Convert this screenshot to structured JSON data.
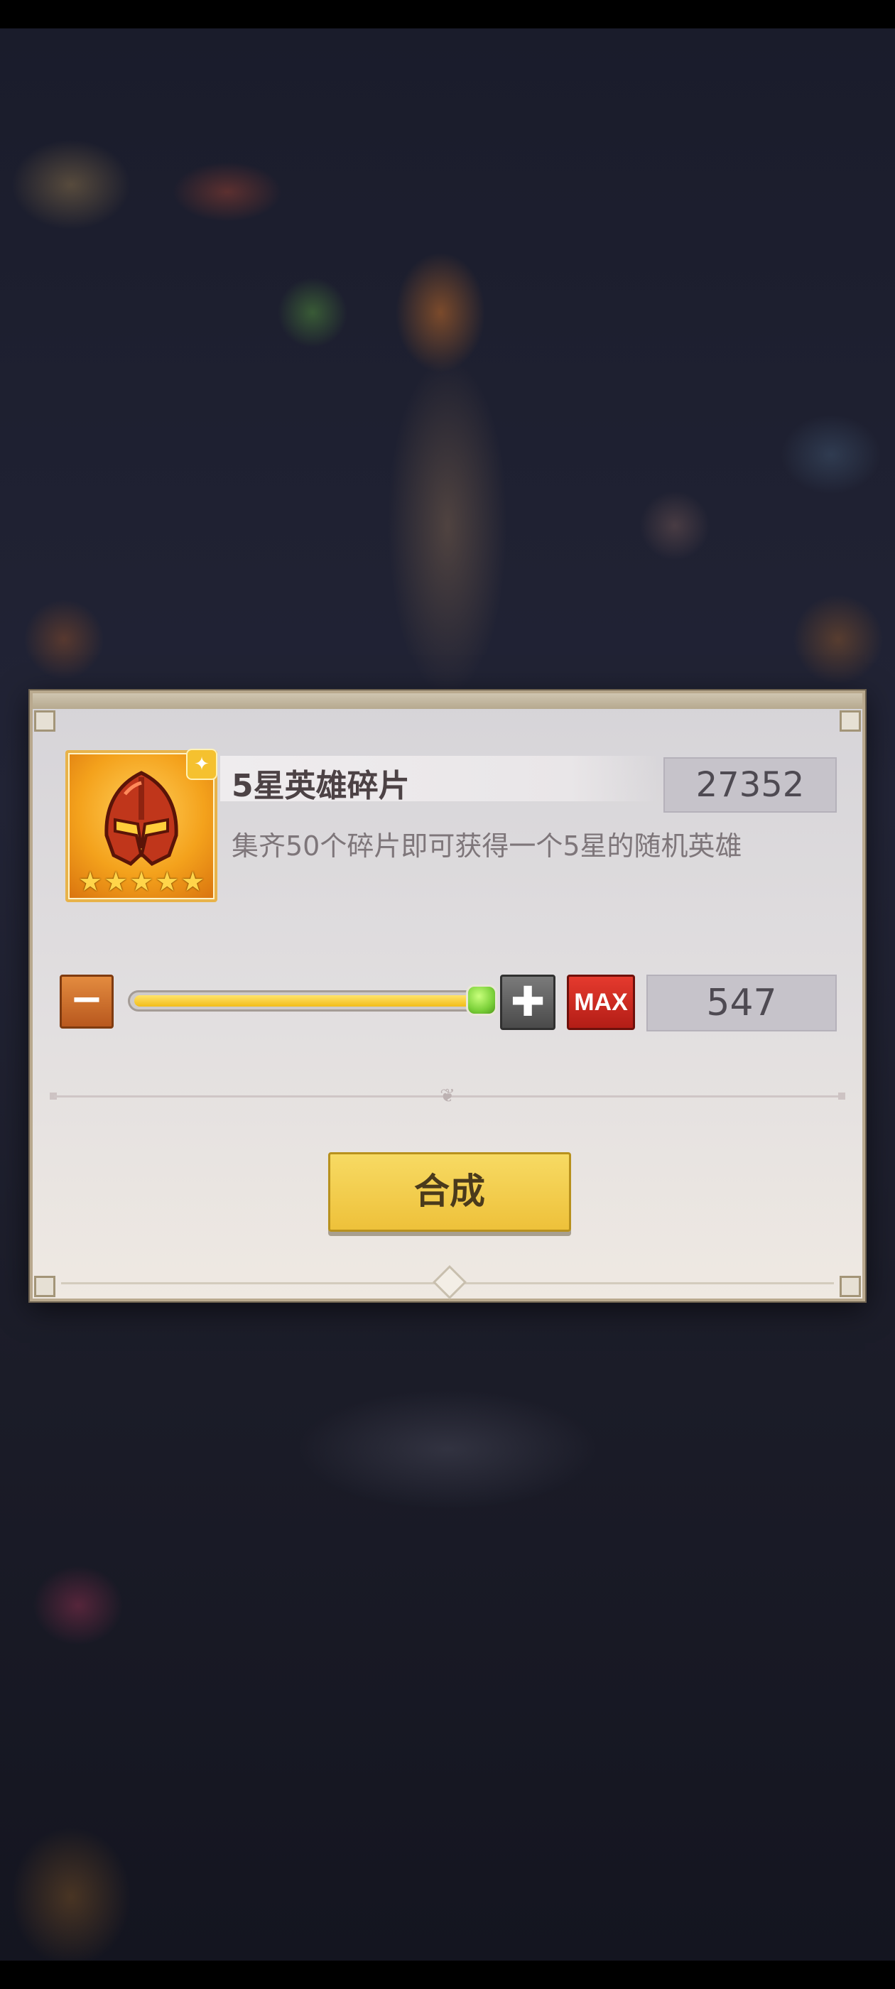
{
  "item": {
    "name": "5星英雄碎片",
    "count": "27352",
    "description": "集齐50个碎片即可获得一个5星的随机英雄",
    "stars": [
      "★",
      "★",
      "★",
      "★",
      "★"
    ]
  },
  "synthesis": {
    "minus_label": "−",
    "plus_label": "✚",
    "max_label": "MAX",
    "quantity": "547",
    "slider_fraction": 1.0,
    "button_label": "合成"
  },
  "colors": {
    "slider_fill": "#f2c41f",
    "compose_button": "#f1c940",
    "max_button": "#d22a20"
  }
}
